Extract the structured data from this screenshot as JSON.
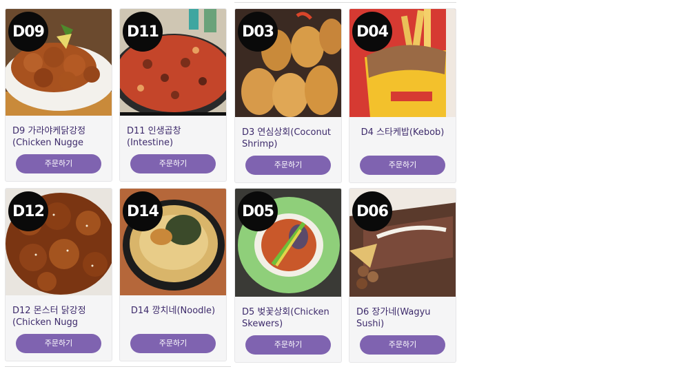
{
  "cards": [
    {
      "badge": "D09",
      "title": "D9 가라야케닭강정 (Chicken Nugge",
      "button": "주문하기"
    },
    {
      "badge": "D11",
      "title": "D11 인생곱창 (Intestine)",
      "button": "주문하기"
    },
    {
      "badge": "D03",
      "title": "D3 연심상회(Coconut Shrimp)",
      "button": "주문하기"
    },
    {
      "badge": "D04",
      "title": "D4 스타케밥(Kebob)",
      "button": "주문하기"
    },
    {
      "badge": "D12",
      "title": "D12 몬스터 닭강정 (Chicken Nugg",
      "button": "주문하기"
    },
    {
      "badge": "D14",
      "title": "D14 깡치네(Noodle)",
      "button": "주문하기"
    },
    {
      "badge": "D05",
      "title": "D5 벚꽃상회(Chicken Skewers)",
      "button": "주문하기"
    },
    {
      "badge": "D06",
      "title": "D6 장가네(Wagyu Sushi)",
      "button": "주문하기"
    }
  ],
  "colors": {
    "button": "#7f63b0",
    "title": "#3d2a6b",
    "card_bg": "#f5f5f6",
    "badge": "#0a0a0a"
  }
}
